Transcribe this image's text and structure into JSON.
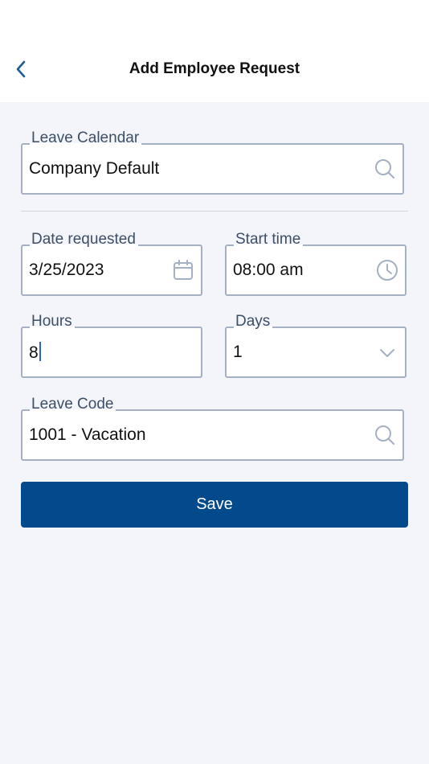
{
  "header": {
    "title": "Add Employee Request"
  },
  "form": {
    "leave_calendar": {
      "label": "Leave Calendar",
      "value": "Company Default"
    },
    "date_requested": {
      "label": "Date requested",
      "value": "3/25/2023"
    },
    "start_time": {
      "label": "Start time",
      "value": "08:00 am"
    },
    "hours": {
      "label": "Hours",
      "value": "8"
    },
    "days": {
      "label": "Days",
      "value": "1"
    },
    "leave_code": {
      "label": "Leave Code",
      "value": "1001 - Vacation"
    },
    "save_label": "Save"
  },
  "colors": {
    "accent": "#034a8c",
    "background": "#f3f5fa",
    "field_border": "#a5b0c3",
    "back_icon": "#1f5a9a"
  },
  "icons": {
    "back": "chevron-left-icon",
    "search": "search-icon",
    "calendar": "calendar-icon",
    "clock": "clock-icon",
    "dropdown": "chevron-down-icon"
  }
}
